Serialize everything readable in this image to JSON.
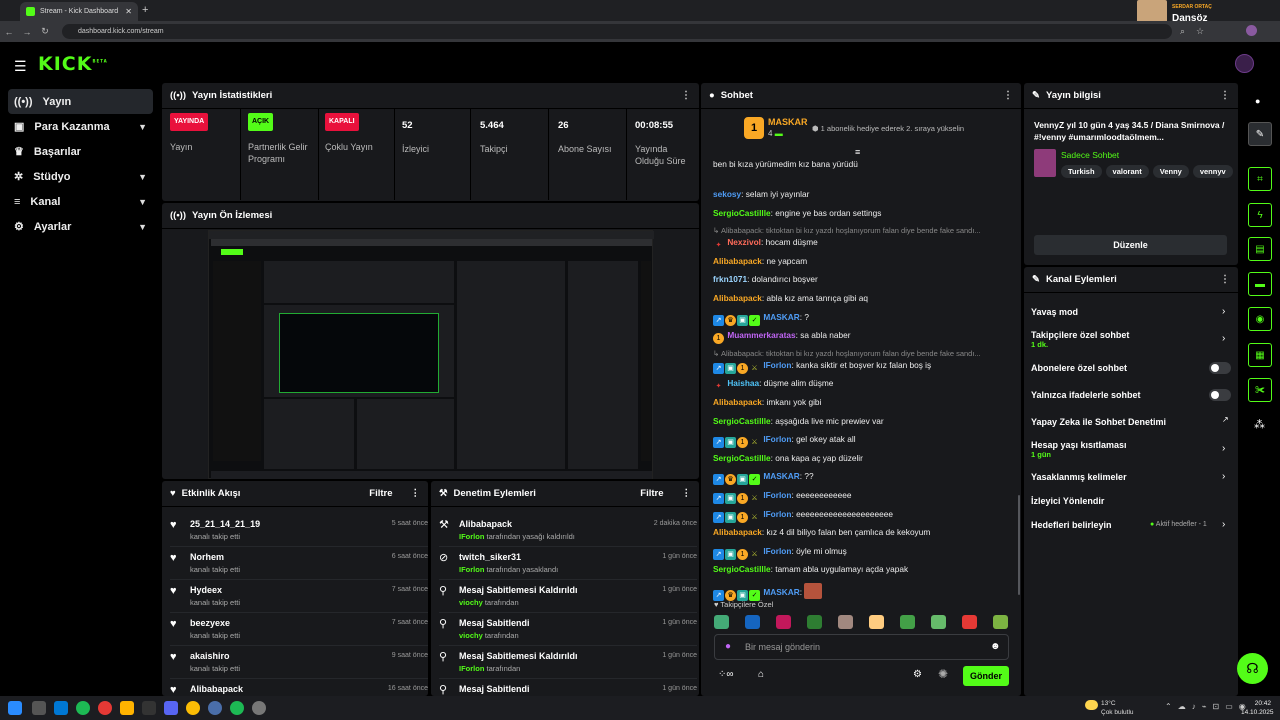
{
  "browser": {
    "tab_title": "Stream - Kick Dashboard",
    "url": "dashboard.kick.com/stream",
    "profile_role": "SERDAR ORTAÇ",
    "profile_name": "Dansöz"
  },
  "brand": {
    "logo": "KICK",
    "beta": "BETA",
    "accent": "#53fc18"
  },
  "sidebar": {
    "items": [
      {
        "label": "Yayın",
        "icon": "broadcast-icon"
      },
      {
        "label": "Para Kazanma",
        "icon": "wallet-icon"
      },
      {
        "label": "Başarılar",
        "icon": "trophy-icon"
      },
      {
        "label": "Stüdyo",
        "icon": "gear-icon"
      },
      {
        "label": "Kanal",
        "icon": "hamburger-icon"
      },
      {
        "label": "Ayarlar",
        "icon": "settings-icon"
      }
    ]
  },
  "stats": {
    "title": "Yayın İstatistikleri",
    "items": [
      {
        "badge": "YAYINDA",
        "label": "Yayın"
      },
      {
        "badge": "AÇIK",
        "label": "Partnerlik Gelir Programı"
      },
      {
        "badge": "KAPALI",
        "label": "Çoklu Yayın"
      },
      {
        "value": "52",
        "label": "İzleyici"
      },
      {
        "value": "5.464",
        "label": "Takipçi"
      },
      {
        "value": "26",
        "label": "Abone Sayısı"
      },
      {
        "value": "00:08:55",
        "label": "Yayında Olduğu Süre"
      }
    ]
  },
  "preview": {
    "title": "Yayın Ön İzlemesi"
  },
  "activity": {
    "title": "Etkinlik Akışı",
    "filter": "Filtre",
    "rows": [
      {
        "name": "25_21_14_21_19",
        "action": "kanalı takip etti",
        "time": "5 saat önce"
      },
      {
        "name": "Norhem",
        "action": "kanalı takip etti",
        "time": "6 saat önce"
      },
      {
        "name": "Hydeex",
        "action": "kanalı takip etti",
        "time": "7 saat önce"
      },
      {
        "name": "beezyexe",
        "action": "kanalı takip etti",
        "time": "7 saat önce"
      },
      {
        "name": "akaishiro",
        "action": "kanalı takip etti",
        "time": "9 saat önce"
      },
      {
        "name": "Alibabapack",
        "action": "",
        "time": "16 saat önce"
      }
    ]
  },
  "moderation": {
    "title": "Denetim Eylemleri",
    "filter": "Filtre",
    "rows": [
      {
        "name": "Alibabapack",
        "by": "IForlon",
        "action": " tarafından yasağı kaldırıldı",
        "time": "2 dakika önce"
      },
      {
        "name": "twitch_siker31",
        "by": "IForlon",
        "action": " tarafından yasaklandı",
        "time": "1 gün önce"
      },
      {
        "name": "Mesaj Sabitlemesi Kaldırıldı",
        "by": "viochy",
        "action": " tarafından",
        "time": "1 gün önce"
      },
      {
        "name": "Mesaj Sabitlendi",
        "by": "viochy",
        "action": " tarafından",
        "time": "1 gün önce"
      },
      {
        "name": "Mesaj Sabitlemesi Kaldırıldı",
        "by": "IForlon",
        "action": " tarafından",
        "time": "1 gün önce"
      },
      {
        "name": "Mesaj Sabitlendi",
        "by": "",
        "action": "",
        "time": "1 gün önce"
      }
    ]
  },
  "chat": {
    "title": "Sohbet",
    "pinned_user": "MASKAR",
    "pinned_count": "4",
    "pinned_rank": "1",
    "pinned_msg": "1 abonelik hediye ederek 2. sıraya yükselin",
    "messages": [
      {
        "user": "",
        "text": "ben bi kıza yürümedim kız bana yürüdü",
        "color": "u-o"
      },
      {
        "user": "sekosy",
        "text": "selam iyi yayınlar",
        "color": "u-b"
      },
      {
        "user": "SergioCastillle",
        "text": "engine ye bas ordan settings",
        "color": "u-g"
      },
      {
        "user": "Nexzivol",
        "text": "hocam düşme",
        "color": "u-r",
        "reply": "Alibabapack: tiktoktan bi kız yazdı hoşlanıyorum falan diye bende fake sandı..."
      },
      {
        "user": "Alibabapack",
        "text": "ne yapcam",
        "color": "u-o"
      },
      {
        "user": "frkn1071",
        "text": "dolandırıcı boşver",
        "color": "u-p"
      },
      {
        "user": "Alibabapack",
        "text": "abla kız ama tanrıça gibi aq",
        "color": "u-o"
      },
      {
        "user": "MASKAR",
        "text": "?",
        "color": "u-b"
      },
      {
        "user": "Muammerkaratas",
        "text": "sa abla naber",
        "color": "u-m"
      },
      {
        "user": "IForlon",
        "text": "kanka siktir et boşver kız falan boş iş",
        "color": "u-b",
        "reply": "Alibabapack: tiktoktan bi kız yazdı hoşlanıyorum falan diye bende fake sandı..."
      },
      {
        "user": "Haishaa",
        "text": "düşme alim düşme",
        "color": "u-c"
      },
      {
        "user": "Alibabapack",
        "text": "imkanı yok gibi",
        "color": "u-o"
      },
      {
        "user": "SergioCastillle",
        "text": "aşşağıda live mic prewiev var",
        "color": "u-g"
      },
      {
        "user": "IForlon",
        "text": "gel okey atak all",
        "color": "u-b"
      },
      {
        "user": "SergioCastillle",
        "text": "ona kapa aç yap düzelir",
        "color": "u-g"
      },
      {
        "user": "MASKAR",
        "text": "??",
        "color": "u-b"
      },
      {
        "user": "IForlon",
        "text": "eeeeeeeeeeee",
        "color": "u-b"
      },
      {
        "user": "IForlon",
        "text": "eeeeeeeeeeeeeeeeeeeee",
        "color": "u-b"
      },
      {
        "user": "Alibabapack",
        "text": "kız 4 dil biliyo falan ben çamlıca de kekoyum",
        "color": "u-o"
      },
      {
        "user": "IForlon",
        "text": "öyle mi olmuş",
        "color": "u-b"
      },
      {
        "user": "SergioCastillle",
        "text": "tamam abla uygulamayı açda yapak",
        "color": "u-g"
      },
      {
        "user": "MASKAR",
        "text": "",
        "color": "u-b"
      }
    ],
    "followers_only": "Takipçilere Özel",
    "input_placeholder": "Bir mesaj gönderin",
    "send": "Gönder"
  },
  "stream_info": {
    "title": "Yayın bilgisi",
    "stream_title": "VennyZ yıl 10 gün 4 yaş 34.5 / Diana Smirnova / #!venny #umarımloodtaölmem...",
    "category": "Sadece Sohbet",
    "tags": [
      "Turkish",
      "valorant",
      "Venny",
      "vennyv"
    ],
    "edit": "Düzenle"
  },
  "channel_actions": {
    "title": "Kanal Eylemleri",
    "rows": [
      {
        "label": "Yavaş mod",
        "sub": "",
        "control": "arrow"
      },
      {
        "label": "Takipçilere özel sohbet",
        "sub": "1 dk.",
        "control": "arrow"
      },
      {
        "label": "Abonelere özel sohbet",
        "sub": "",
        "control": "toggle"
      },
      {
        "label": "Yalnızca ifadelerle sohbet",
        "sub": "",
        "control": "toggle"
      },
      {
        "label": "Yapay Zeka ile Sohbet Denetimi",
        "sub": "",
        "control": "external"
      },
      {
        "label": "Hesap yaşı kısıtlaması",
        "sub": "1 gün",
        "control": "arrow"
      },
      {
        "label": "Yasaklanmış kelimeler",
        "sub": "",
        "control": "arrow"
      },
      {
        "label": "İzleyici Yönlendir",
        "sub": "",
        "control": "none"
      },
      {
        "label": "Hedefleri belirleyin",
        "sub": "",
        "control": "arrow",
        "extra": "Aktif hedefler - 1"
      }
    ]
  },
  "taskbar": {
    "weather_temp": "13°C",
    "weather_desc": "Çok bulutlu",
    "time": "20:42",
    "date": "14.10.2025"
  }
}
